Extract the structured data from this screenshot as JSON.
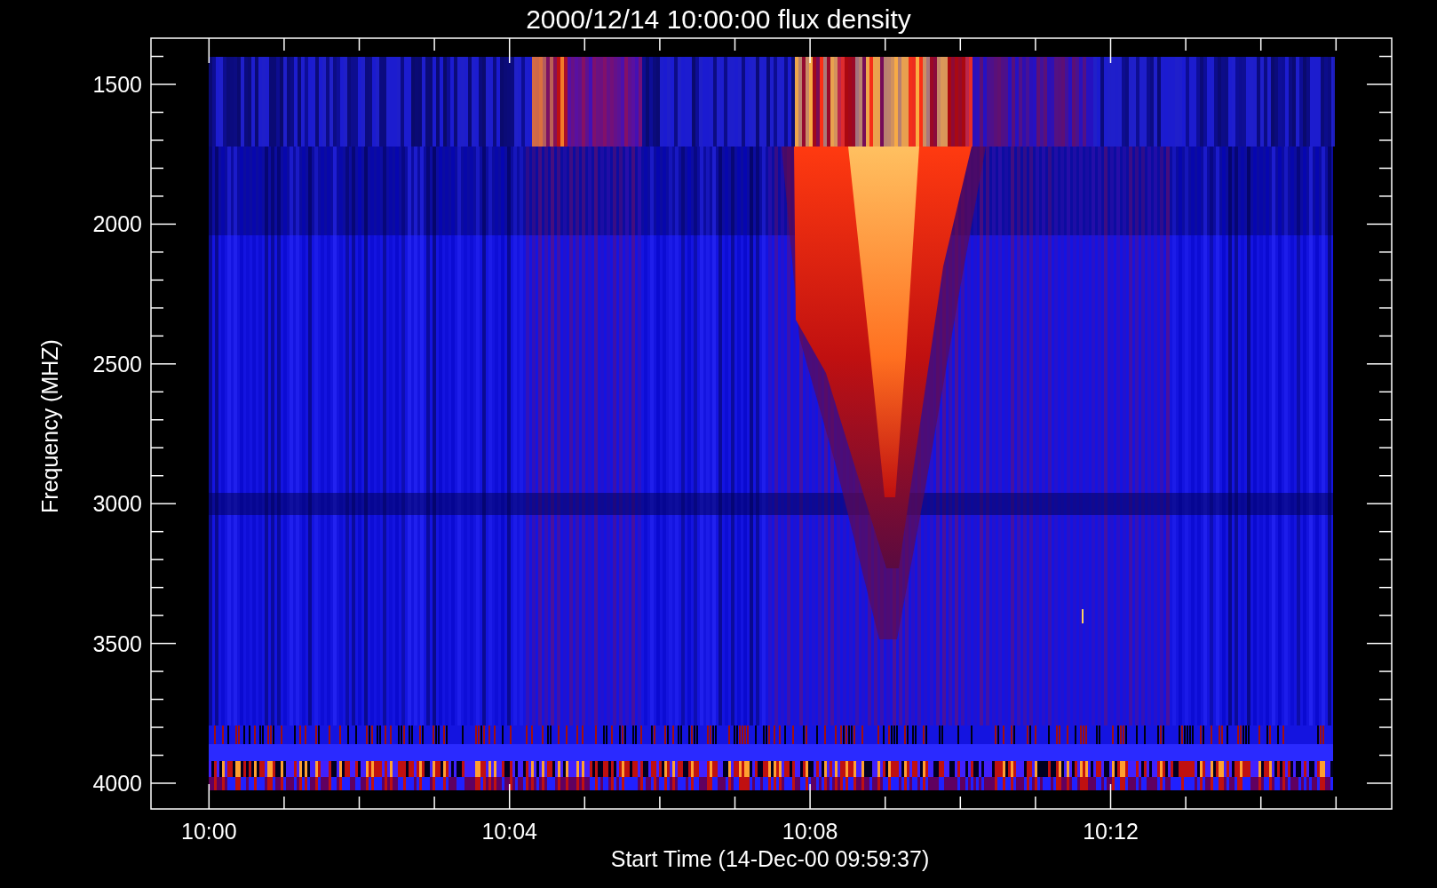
{
  "title": "2000/12/14 10:00:00 flux density",
  "y_axis": {
    "label": "Frequency (MHZ)",
    "ticks": [
      "1500",
      "2000",
      "2500",
      "3000",
      "3500",
      "4000"
    ]
  },
  "x_axis": {
    "label": "Start Time (14-Dec-00 09:59:37)",
    "ticks": [
      "10:00",
      "10:04",
      "10:08",
      "10:12"
    ]
  }
}
